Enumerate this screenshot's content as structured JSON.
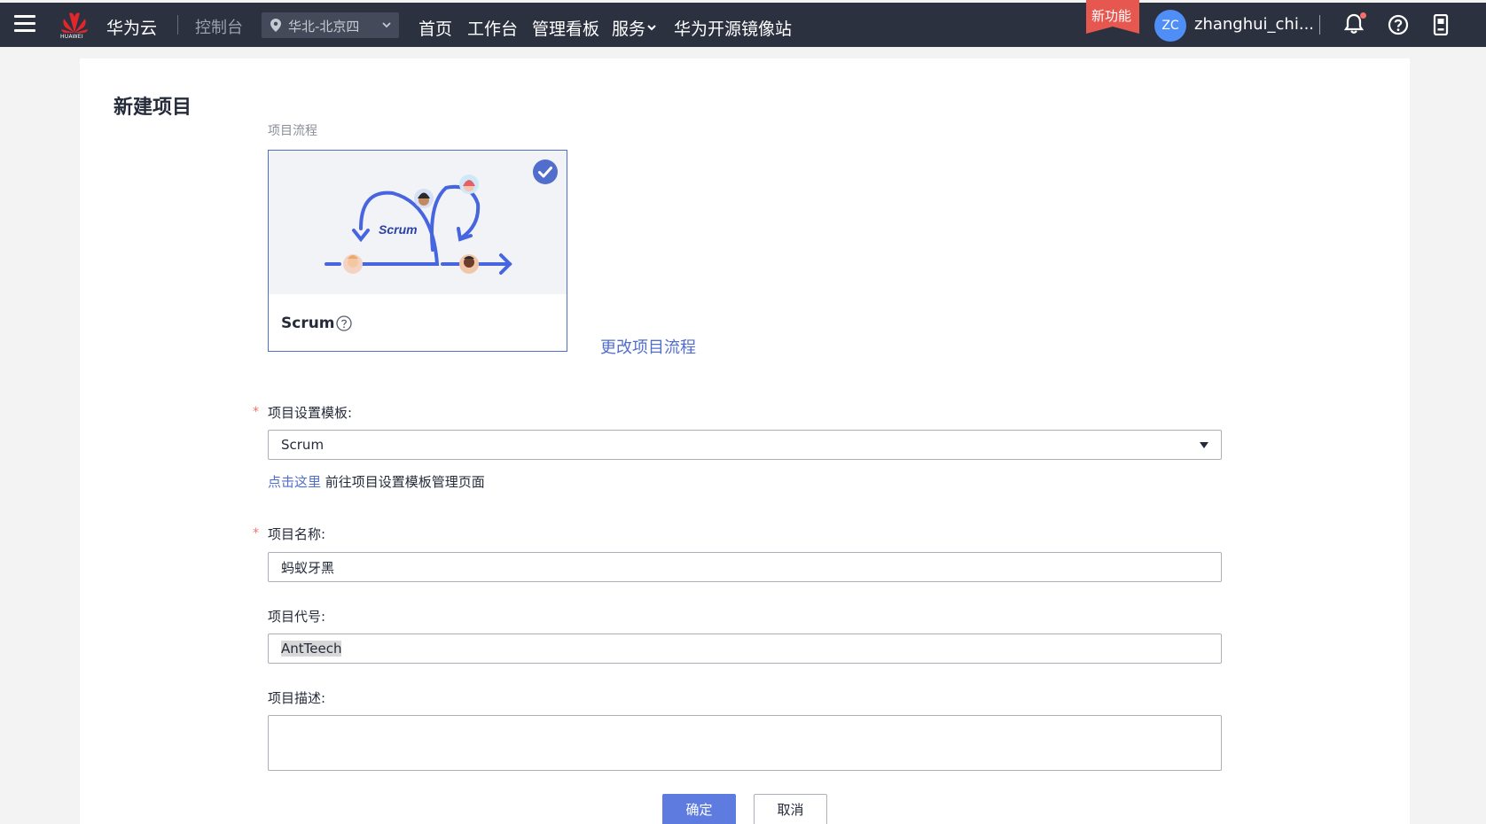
{
  "topbar": {
    "logo_text": "HUAWEI",
    "brand": "华为云",
    "console": "控制台",
    "region": "华北-北京四",
    "nav": [
      "首页",
      "工作台",
      "管理看板",
      "服务",
      "华为开源镜像站"
    ],
    "new_feature": "新功能",
    "avatar_initials": "ZC",
    "username": "zhanghui_chi..."
  },
  "page": {
    "title": "新建项目",
    "flow_label": "项目流程",
    "card": {
      "illus_text": "Scrum",
      "name": "Scrum"
    },
    "change_flow": "更改项目流程"
  },
  "form": {
    "required_mark": "*",
    "template_label": "项目设置模板:",
    "template_value": "Scrum",
    "hint_link": "点击这里",
    "hint_text": " 前往项目设置模板管理页面",
    "name_label": "项目名称:",
    "name_value": "蚂蚁牙黑",
    "code_label": "项目代号:",
    "code_value": "AntTeech",
    "desc_label": "项目描述:",
    "desc_value": ""
  },
  "buttons": {
    "ok": "确定",
    "cancel": "取消"
  },
  "colors": {
    "topbar": "#2c3140",
    "accent": "#526ecc",
    "primary_button": "#5e7ce0",
    "required": "#f66f6a",
    "new_feature_badge": "#e5574f"
  }
}
